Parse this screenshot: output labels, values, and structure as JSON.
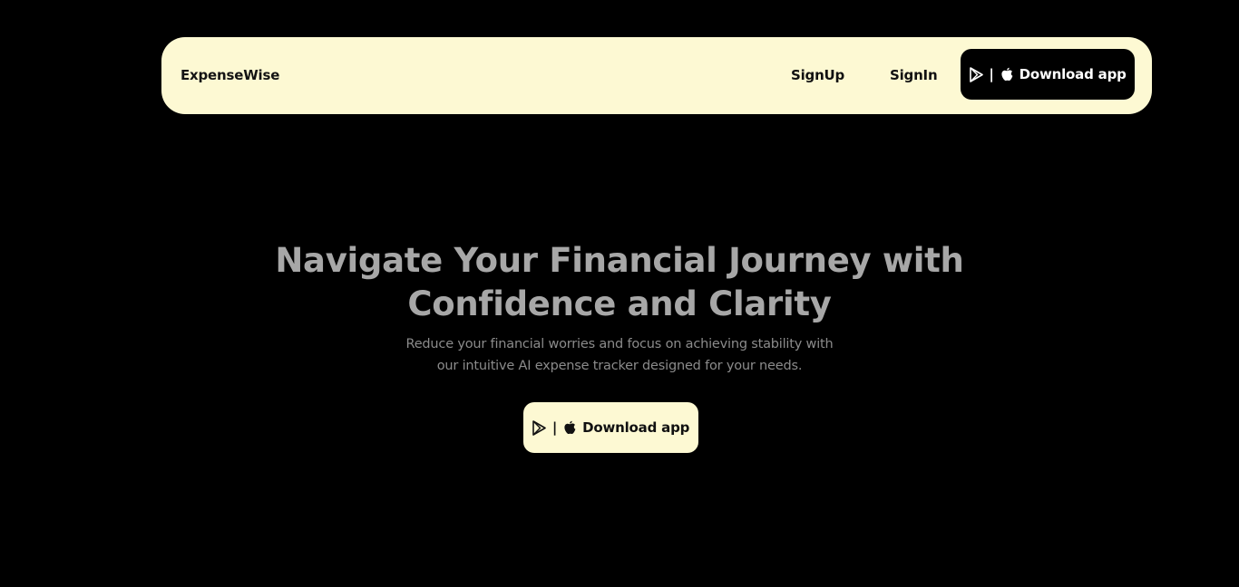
{
  "navbar": {
    "brand": "ExpenseWise",
    "links": {
      "signup": "SignUp",
      "signin": "SignIn"
    },
    "download": {
      "separator": "|",
      "label": "Download app",
      "icons": [
        "google-play-icon",
        "apple-icon"
      ]
    }
  },
  "hero": {
    "title_line1": "Navigate Your Financial Journey with",
    "title_line2": "Confidence and Clarity",
    "subtitle_line1": "Reduce your financial worries and focus on achieving stability with",
    "subtitle_line2": "our intuitive AI expense tracker designed for your needs.",
    "download": {
      "separator": "|",
      "label": "Download app",
      "icons": [
        "google-play-icon",
        "apple-icon"
      ]
    }
  },
  "colors": {
    "background": "#000000",
    "navbar_bg": "#fdf9d3",
    "hero_title": "#a7a7a7",
    "hero_subtitle": "#8b8b8b",
    "dark_button_bg": "#000000",
    "light_button_bg": "#fdf9d3"
  }
}
